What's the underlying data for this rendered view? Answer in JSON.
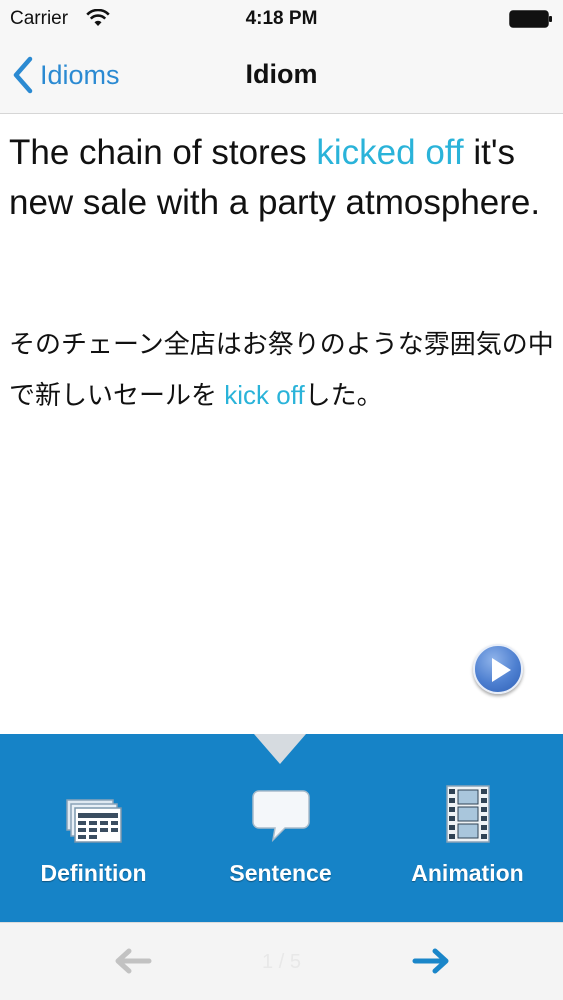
{
  "status_bar": {
    "carrier": "Carrier",
    "time": "4:18 PM"
  },
  "nav": {
    "back_label": "Idioms",
    "title": "Idiom"
  },
  "sentence": {
    "english_before": "The chain of stores ",
    "english_highlight": "kicked off",
    "english_after": " it's new sale with a party atmosphere.",
    "japanese_before": "そのチェーン全店はお祭りのような雰囲気の中 で新しいセールを ",
    "japanese_highlight": "kick off",
    "japanese_after": "した。"
  },
  "tabs": [
    {
      "label": "Definition",
      "icon": "list-icon"
    },
    {
      "label": "Sentence",
      "icon": "speech-bubble-icon"
    },
    {
      "label": "Animation",
      "icon": "film-strip-icon"
    }
  ],
  "pager": {
    "counter": "1 / 5"
  },
  "colors": {
    "accent": "#2b8ad2",
    "highlight": "#2ab3d9",
    "tab_bar": "#1683c7",
    "next_arrow": "#1a86c9",
    "prev_arrow_disabled": "#c2c2c2"
  }
}
